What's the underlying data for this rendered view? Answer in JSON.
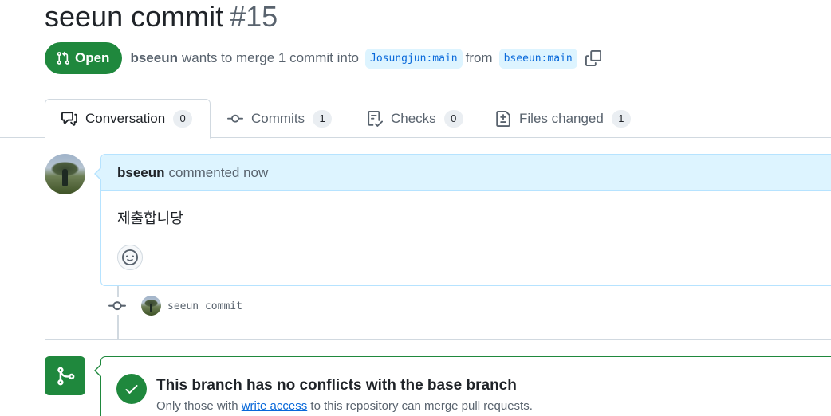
{
  "pr": {
    "title": "seeun commit",
    "number": "#15",
    "state_label": "Open",
    "author": "bseeun",
    "merge_text": "wants to merge 1 commit into",
    "base_branch": "Josungjun:main",
    "from_text": "from",
    "head_branch": "bseeun:main"
  },
  "tabs": [
    {
      "label": "Conversation",
      "count": "0",
      "icon": "comment-discussion-icon"
    },
    {
      "label": "Commits",
      "count": "1",
      "icon": "git-commit-icon"
    },
    {
      "label": "Checks",
      "count": "0",
      "icon": "checklist-icon"
    },
    {
      "label": "Files changed",
      "count": "1",
      "icon": "file-diff-icon"
    }
  ],
  "comment": {
    "author": "bseeun",
    "action": "commented now",
    "body": "제출합니당",
    "reaction_icon": "smiley-icon"
  },
  "commit": {
    "message": "seeun commit"
  },
  "merge": {
    "title": "This branch has no conflicts with the base branch",
    "sub_before": "Only those with",
    "sub_link": "write access",
    "sub_after": "to this repository can merge pull requests."
  },
  "colors": {
    "accent_green": "#1f883d",
    "link_blue": "#0969da",
    "comment_header_bg": "#ddf4ff",
    "border": "#d1d9e0"
  }
}
